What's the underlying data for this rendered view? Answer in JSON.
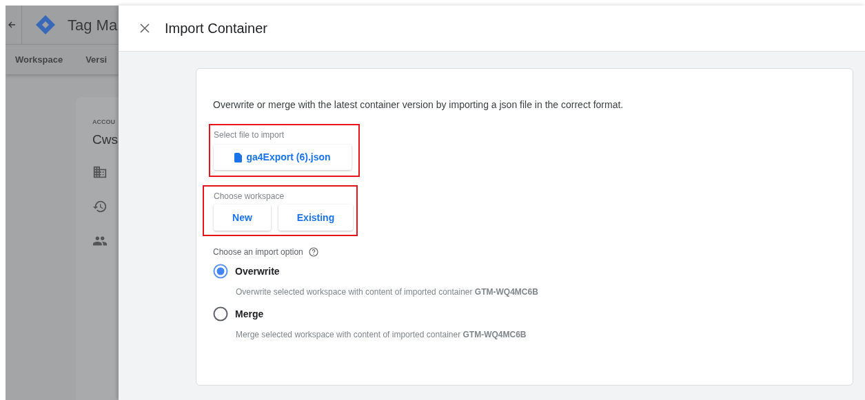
{
  "background_app": {
    "title": "Tag Ma",
    "tabs": [
      {
        "label": "Workspace",
        "selected": false
      },
      {
        "label": "Versi",
        "selected": false
      }
    ],
    "account_card": {
      "label": "ACCOU",
      "name": "Cws"
    }
  },
  "dialog": {
    "title": "Import Container",
    "intro": "Overwrite or merge with the latest container version by importing a json file in the correct format.",
    "file_section": {
      "label": "Select file to import",
      "file_name": "ga4Export (6).json",
      "highlighted": true
    },
    "workspace_section": {
      "label": "Choose workspace",
      "buttons": [
        "New",
        "Existing"
      ],
      "highlighted": true
    },
    "import_option": {
      "label": "Choose an import option",
      "options": [
        {
          "label": "Overwrite",
          "description": "Overwrite selected workspace with content of imported container **GTM-WQ4MC6B**",
          "selected": true
        },
        {
          "label": "Merge",
          "description": "Merge selected workspace with content of imported container **GTM-WQ4MC6B**",
          "selected": false
        }
      ]
    }
  }
}
